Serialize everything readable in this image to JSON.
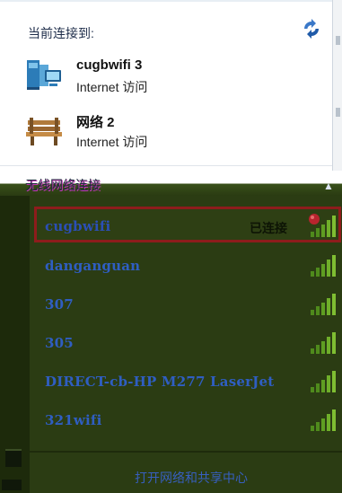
{
  "header": {
    "current_label": "当前连接到:"
  },
  "connections": [
    {
      "name": "cugbwifi  3",
      "sub": "Internet 访问",
      "icon": "network-computer-icon"
    },
    {
      "name": "网络  2",
      "sub": "Internet 访问",
      "icon": "bench-network-icon"
    }
  ],
  "wireless": {
    "label": "无线网络连接",
    "networks": [
      {
        "ssid": "cugbwifi",
        "status": "已连接",
        "selected": true,
        "signal": "5/5"
      },
      {
        "ssid": "danganguan",
        "status": "",
        "signal": "5/5"
      },
      {
        "ssid": "307",
        "status": "",
        "signal": "5/5"
      },
      {
        "ssid": "305",
        "status": "",
        "signal": "5/5"
      },
      {
        "ssid": "DIRECT-cb-HP M277 LaserJet",
        "status": "",
        "signal": "5/5"
      },
      {
        "ssid": "321wifi",
        "status": "",
        "signal": "5/5"
      }
    ]
  },
  "footer": {
    "link": "打开网络和共享中心"
  },
  "colors": {
    "accent": "#2f5ec2",
    "selected_border": "#8e1c1c",
    "list_bg": "#2b3c13"
  }
}
